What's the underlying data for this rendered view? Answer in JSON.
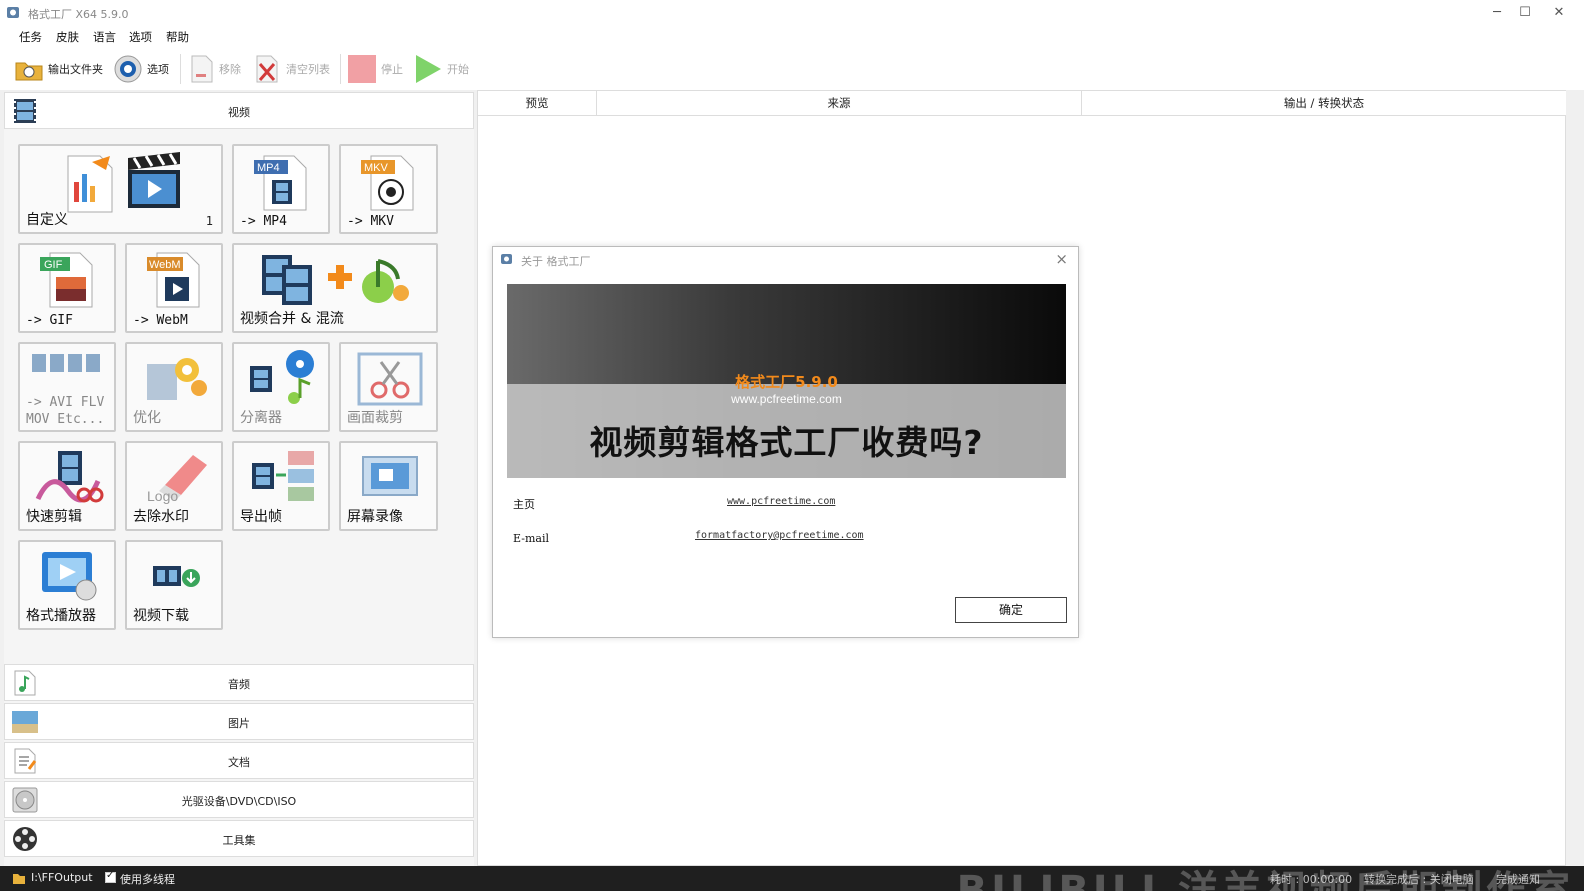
{
  "window": {
    "title": "格式工厂 X64 5.9.0",
    "controls": {
      "minimize": "─",
      "maximize": "☐",
      "close": "✕"
    }
  },
  "menu": [
    "任务",
    "皮肤",
    "语言",
    "选项",
    "帮助"
  ],
  "toolbar": {
    "output_folder": "输出文件夹",
    "options": "选项",
    "remove": "移除",
    "clear_list": "清空列表",
    "stop": "停止",
    "start": "开始"
  },
  "categories": {
    "video": "视频",
    "audio": "音频",
    "image": "图片",
    "document": "文档",
    "optical": "光驱设备\\DVD\\CD\\ISO",
    "tools": "工具集"
  },
  "tiles": {
    "custom": {
      "label": "自定义",
      "badge": "1"
    },
    "mp4": {
      "label": "-> MP4",
      "tag": "MP4"
    },
    "mkv": {
      "label": "-> MKV",
      "tag": "MKV"
    },
    "gif": {
      "label": "-> GIF",
      "tag": "GIF"
    },
    "webm": {
      "label": "-> WebM",
      "tag": "WebM"
    },
    "merge": {
      "label": "视频合并 & 混流"
    },
    "avi": {
      "label_line1": "-> AVI FLV",
      "label_line2": "MOV Etc..."
    },
    "optimize": {
      "label": "优化"
    },
    "splitter": {
      "label": "分离器"
    },
    "crop": {
      "label": "画面裁剪"
    },
    "quick_cut": {
      "label": "快速剪辑"
    },
    "remove_logo": {
      "label": "去除水印",
      "art": "Logo"
    },
    "export_frames": {
      "label": "导出帧"
    },
    "screen_record": {
      "label": "屏幕录像"
    },
    "player": {
      "label": "格式播放器"
    },
    "download": {
      "label": "视频下载"
    }
  },
  "list_columns": [
    "预览",
    "来源",
    "输出 / 转换状态"
  ],
  "dialog": {
    "title": "关于 格式工厂",
    "close": "×",
    "banner_version": "格式工厂5.9.0",
    "banner_site": "www.pcfreetime.com",
    "banner_overlay": "视频剪辑格式工厂收费吗?",
    "homepage_label": "主页",
    "homepage_link": "www.pcfreetime.com",
    "email_label": "E-mail",
    "email_link": "formatfactory@pcfreetime.com",
    "ok": "确定"
  },
  "statusbar": {
    "path": "I:\\FFOutput",
    "multithread": "使用多线程",
    "elapsed": "耗时 : 00:00:00",
    "after_convert": "转换完成后 : 关闭电脑",
    "notify": "完成通知"
  },
  "watermark": "BILIBILI 洋羊视频后期制作室"
}
